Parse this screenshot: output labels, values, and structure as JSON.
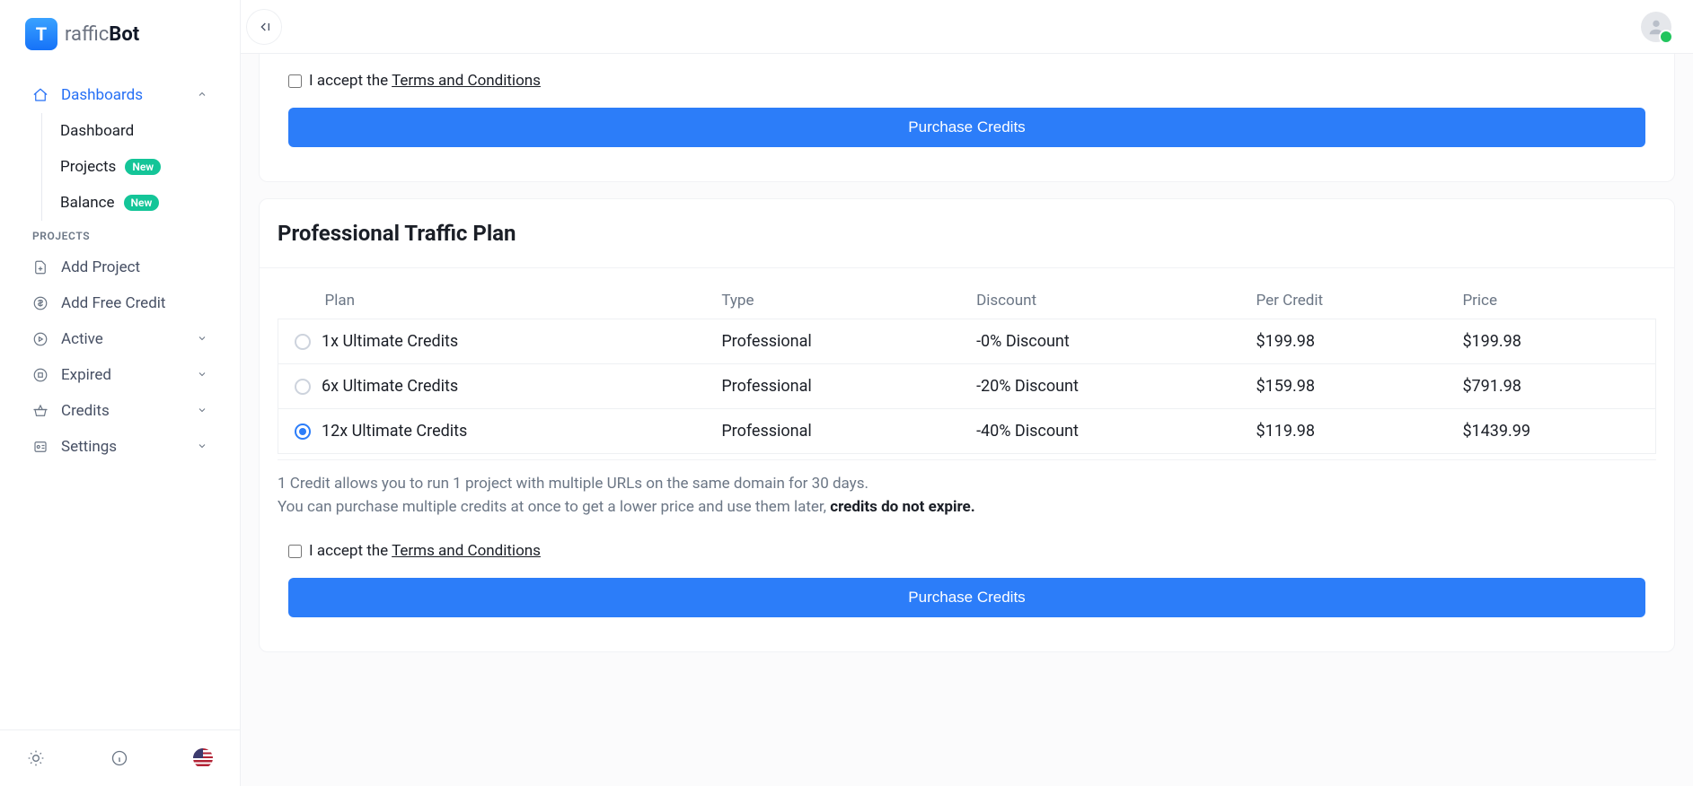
{
  "logo": {
    "badge": "T",
    "word1": "raffic",
    "word2": "Bot"
  },
  "sidebar": {
    "dashboards_label": "Dashboards",
    "sub": {
      "dashboard": "Dashboard",
      "projects": "Projects",
      "balance": "Balance",
      "new_badge": "New"
    },
    "projects_header": "PROJECTS",
    "items": {
      "add_project": "Add Project",
      "add_free_credit": "Add Free Credit",
      "active": "Active",
      "expired": "Expired",
      "credits": "Credits",
      "settings": "Settings"
    }
  },
  "terms": {
    "prefix": "I accept the ",
    "link": "Terms and Conditions"
  },
  "buttons": {
    "purchase": "Purchase Credits"
  },
  "plan_card": {
    "title": "Professional Traffic Plan",
    "headers": {
      "plan": "Plan",
      "type": "Type",
      "discount": "Discount",
      "per_credit": "Per Credit",
      "price": "Price"
    },
    "rows": [
      {
        "plan": "1x Ultimate Credits",
        "type": "Professional",
        "discount": "-0% Discount",
        "per_credit": "$199.98",
        "price": "$199.98",
        "selected": false
      },
      {
        "plan": "6x Ultimate Credits",
        "type": "Professional",
        "discount": "-20% Discount",
        "per_credit": "$159.98",
        "price": "$791.98",
        "selected": false
      },
      {
        "plan": "12x Ultimate Credits",
        "type": "Professional",
        "discount": "-40% Discount",
        "per_credit": "$119.98",
        "price": "$1439.99",
        "selected": true
      }
    ],
    "info_line1": "1 Credit allows you to run 1 project with multiple URLs on the same domain for 30 days.",
    "info_line2_prefix": "You can purchase multiple credits at once to get a lower price and use them later, ",
    "info_line2_bold": "credits do not expire."
  }
}
